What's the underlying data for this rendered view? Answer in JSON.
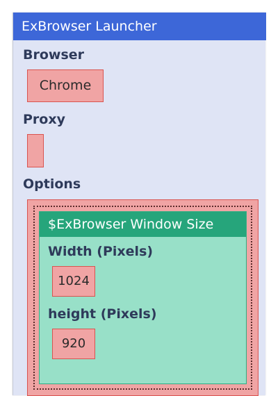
{
  "window": {
    "title": "ExBrowser Launcher"
  },
  "browser": {
    "label": "Browser",
    "value": "Chrome"
  },
  "proxy": {
    "label": "Proxy",
    "value": ""
  },
  "options": {
    "label": "Options",
    "group": {
      "title": "$ExBrowser Window Size",
      "width_label": "Width (Pixels)",
      "width_value": "1024",
      "height_label": "height (Pixels)",
      "height_value": "920"
    }
  },
  "colors": {
    "titlebar": "#3d67d8",
    "window_bg": "#dfe4f5",
    "field_bg": "#f0a4a4",
    "field_border": "#d9534f",
    "group_bg": "#98e0c8",
    "group_header": "#26a57b"
  }
}
